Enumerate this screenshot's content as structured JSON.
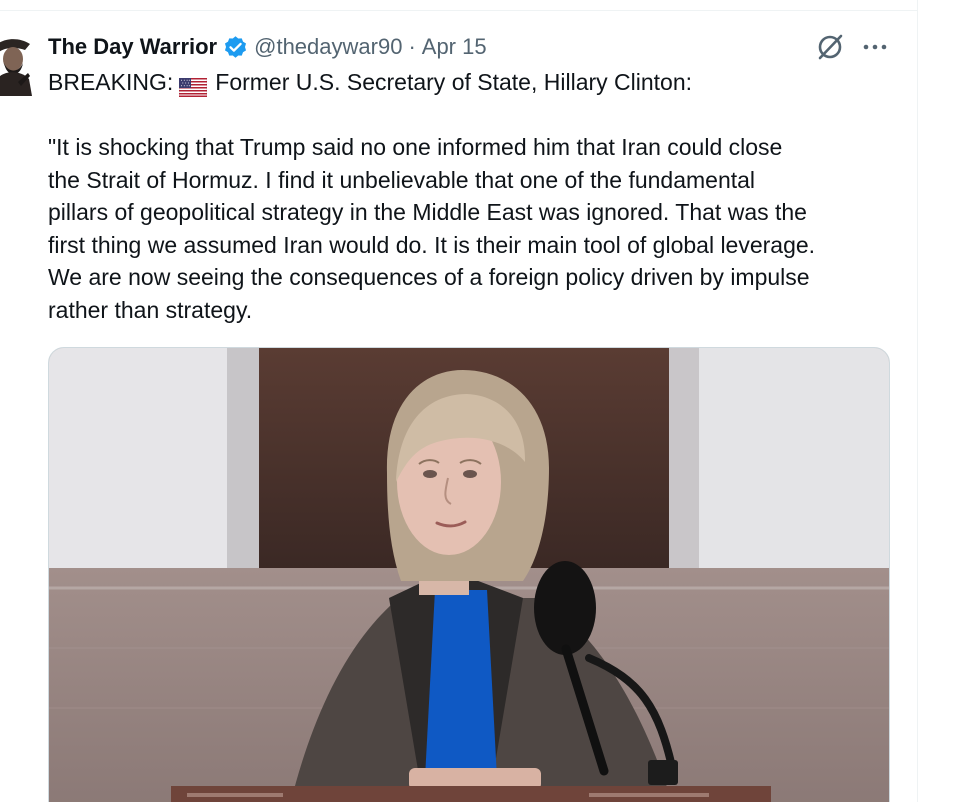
{
  "tweet": {
    "display_name": "The Day Warrior",
    "handle": "@thedaywar90",
    "separator": "·",
    "date": "Apr 15",
    "lead_prefix": "BREAKING:",
    "lead_text": "Former U.S. Secretary of State, Hillary Clinton:",
    "quote_lines": [
      "\"It is shocking that Trump said no one informed him that Iran could close",
      "the Strait of Hormuz. I find it unbelievable that one of the fundamental",
      "pillars of geopolitical strategy in the Middle East was ignored. That was the",
      "first thing we assumed Iran would do. It is their main tool of global leverage.",
      "We are now seeing the consequences of a foreign policy driven by impulse",
      "rather than strategy."
    ]
  },
  "icons": {
    "verified": "verified-badge-icon",
    "flag": "us-flag-icon",
    "grok": "grok-icon",
    "more": "more-options-icon"
  },
  "colors": {
    "text_primary": "#0f1419",
    "text_secondary": "#536471",
    "verified_blue": "#1d9bf0",
    "border": "#cfd9de"
  }
}
